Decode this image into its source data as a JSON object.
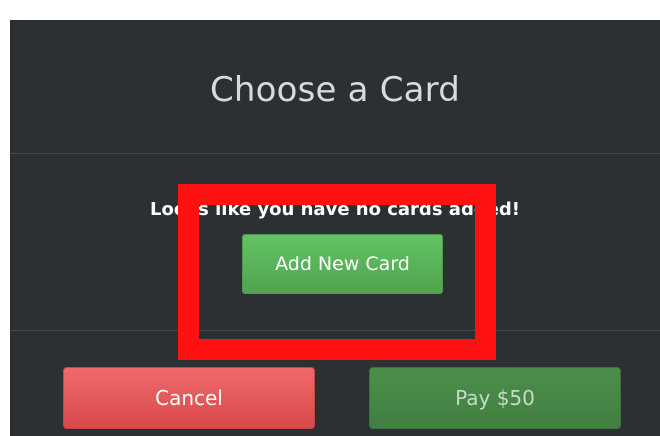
{
  "modal": {
    "title": "Choose a Card",
    "empty_message": "Looks like you have no cards added!",
    "add_card_label": "Add New Card"
  },
  "footer": {
    "cancel_label": "Cancel",
    "pay_label": "Pay $50"
  },
  "colors": {
    "modal_background": "#2c3032",
    "primary_green": "#5cb85c",
    "danger_red": "#e55b5b",
    "disabled_green": "#458945",
    "highlight_red": "#ff1111"
  }
}
